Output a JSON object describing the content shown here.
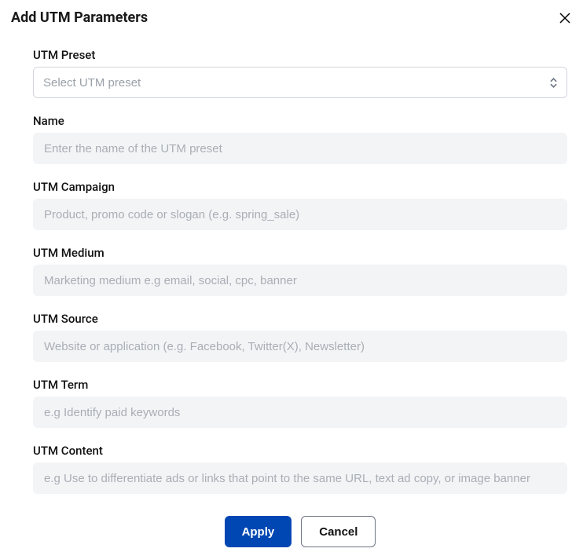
{
  "modal": {
    "title": "Add UTM Parameters",
    "fields": {
      "utm_preset": {
        "label": "UTM Preset",
        "placeholder": "Select UTM preset",
        "value": ""
      },
      "name": {
        "label": "Name",
        "placeholder": "Enter the name of the UTM preset",
        "value": ""
      },
      "utm_campaign": {
        "label": "UTM Campaign",
        "placeholder": "Product, promo code or slogan (e.g. spring_sale)",
        "value": ""
      },
      "utm_medium": {
        "label": "UTM Medium",
        "placeholder": "Marketing medium e.g email, social, cpc, banner",
        "value": ""
      },
      "utm_source": {
        "label": "UTM Source",
        "placeholder": "Website or application (e.g. Facebook, Twitter(X), Newsletter)",
        "value": ""
      },
      "utm_term": {
        "label": "UTM Term",
        "placeholder": "e.g Identify paid keywords",
        "value": ""
      },
      "utm_content": {
        "label": "UTM Content",
        "placeholder": "e.g Use to differentiate ads or links that point to the same URL, text ad copy, or image banner",
        "value": ""
      }
    },
    "actions": {
      "apply": "Apply",
      "cancel": "Cancel"
    }
  }
}
